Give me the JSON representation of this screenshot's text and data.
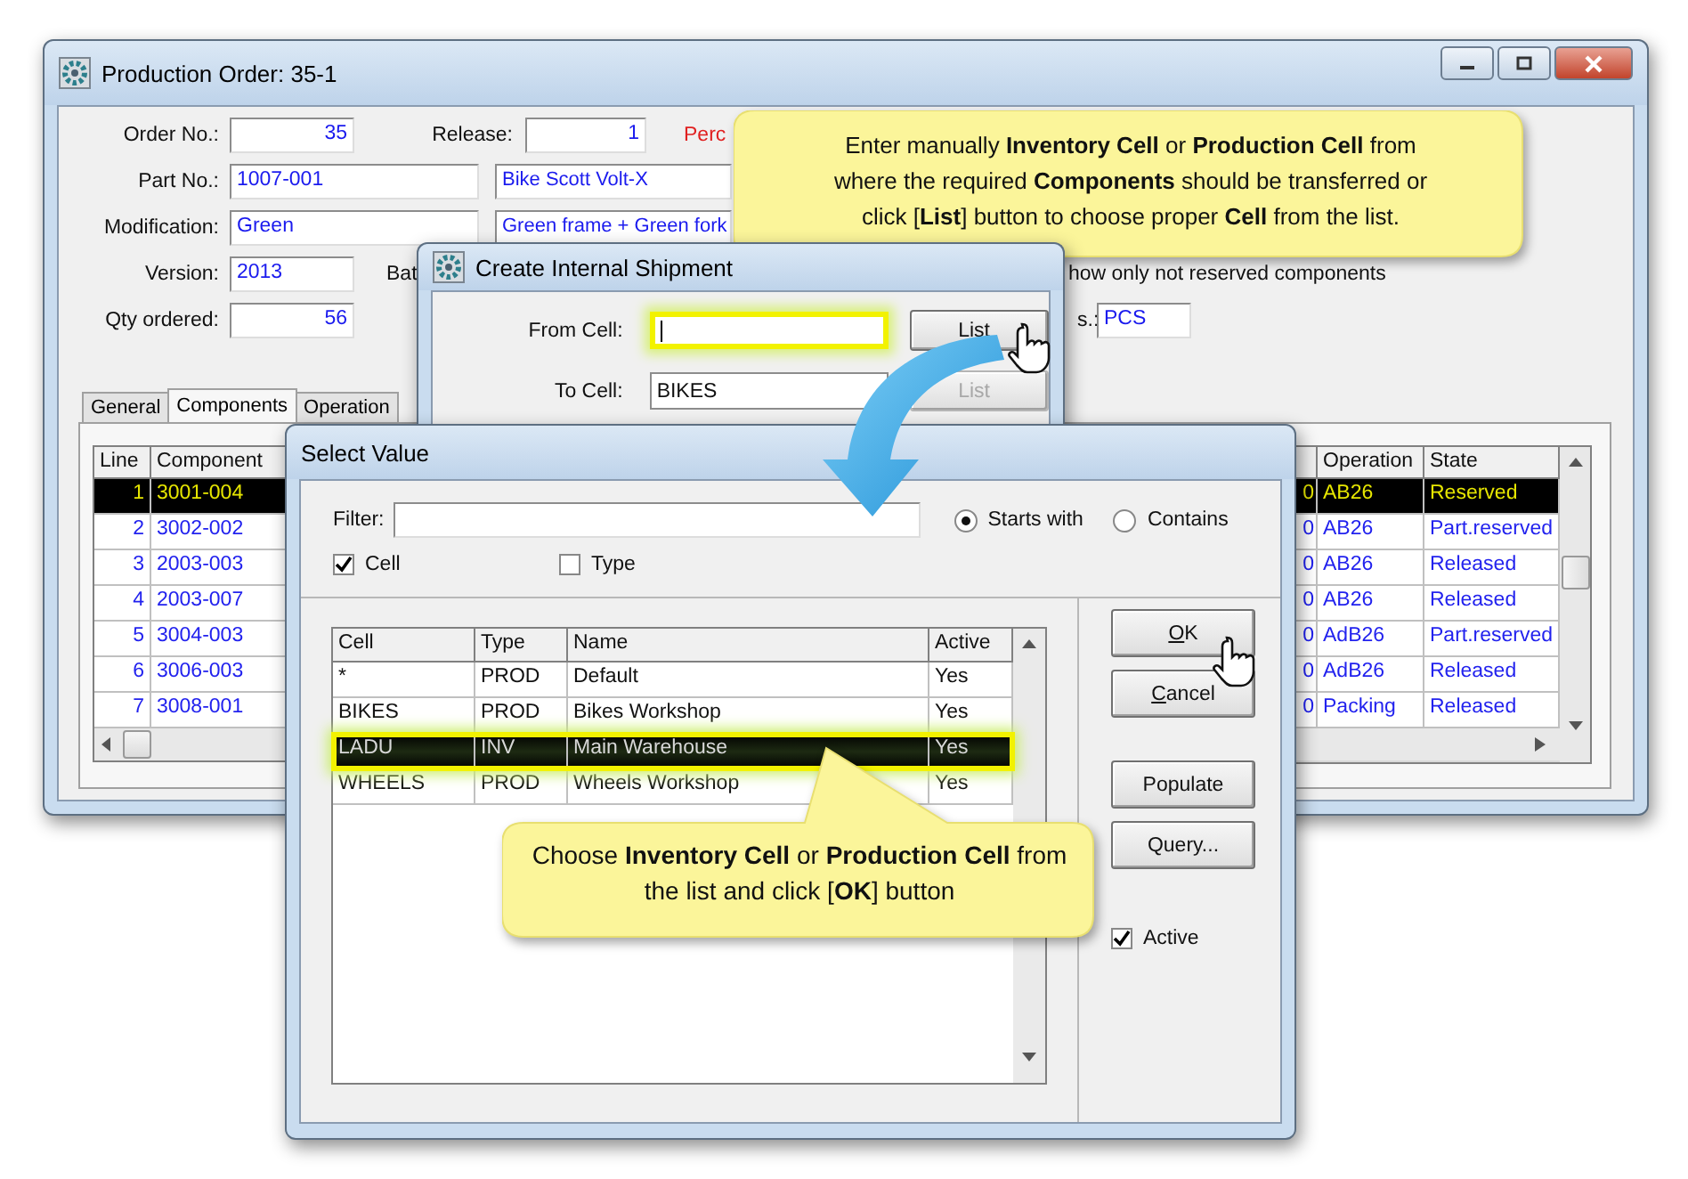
{
  "production_order_window": {
    "title": "Production Order: 35-1",
    "order_no": {
      "label": "Order No.:",
      "value": "35"
    },
    "release": {
      "label": "Release:",
      "value": "1"
    },
    "perc_label": "Perc",
    "part_no": {
      "label": "Part No.:",
      "value": "1007-001",
      "description": "Bike Scott Volt-X"
    },
    "modification": {
      "label": "Modification:",
      "value": "Green",
      "description": "Green frame + Green fork"
    },
    "version": {
      "label": "Version:",
      "value": "2013"
    },
    "batch_label": "Bat",
    "reserved_filter_text": "how only not reserved components",
    "qty_ordered": {
      "label": "Qty ordered:",
      "value": "56"
    },
    "unit": {
      "label": "s.:",
      "value": "PCS"
    },
    "tabs": [
      {
        "label": "General",
        "selected": false
      },
      {
        "label": "Components",
        "selected": true
      },
      {
        "label": "Operation",
        "selected": false
      }
    ],
    "components_table": {
      "left_columns": [
        "Line",
        "Component"
      ],
      "right_columns": [
        "Operation",
        "State"
      ],
      "rows": [
        {
          "line": "1",
          "component": "3001-004",
          "column_3": "0",
          "operation": "AB26",
          "state": "Reserved",
          "selected": true
        },
        {
          "line": "2",
          "component": "3002-002",
          "column_3": "0",
          "operation": "AB26",
          "state": "Part.reserved",
          "selected": false
        },
        {
          "line": "3",
          "component": "2003-003",
          "column_3": "0",
          "operation": "AB26",
          "state": "Released",
          "selected": false
        },
        {
          "line": "4",
          "component": "2003-007",
          "column_3": "0",
          "operation": "AB26",
          "state": "Released",
          "selected": false
        },
        {
          "line": "5",
          "component": "3004-003",
          "column_3": "0",
          "operation": "AdB26",
          "state": "Part.reserved",
          "selected": false
        },
        {
          "line": "6",
          "component": "3006-003",
          "column_3": "0",
          "operation": "AdB26",
          "state": "Released",
          "selected": false
        },
        {
          "line": "7",
          "component": "3008-001",
          "column_3": "0",
          "operation": "Packing",
          "state": "Released",
          "selected": false
        }
      ]
    }
  },
  "shipment_dialog": {
    "title": "Create Internal Shipment",
    "from_cell": {
      "label": "From Cell:",
      "highlighted": true
    },
    "to_cell": {
      "label": "To Cell:",
      "value": "BIKES"
    },
    "list_buttons": [
      {
        "label": "List",
        "disabled": false
      },
      {
        "label": "List",
        "disabled": true
      }
    ]
  },
  "select_value_dialog": {
    "title": "Select Value",
    "filter_label": "Filter:",
    "match_modes": [
      {
        "label": "Starts with",
        "selected": true
      },
      {
        "label": "Contains",
        "selected": false
      }
    ],
    "search_fields": [
      {
        "label": "Cell",
        "checked": true
      },
      {
        "label": "Type",
        "checked": false
      }
    ],
    "list": {
      "columns": [
        "Cell",
        "Type",
        "Name",
        "Active"
      ],
      "rows": [
        {
          "cell": "*",
          "type": "PROD",
          "name": "Default",
          "active": "Yes",
          "selected": false
        },
        {
          "cell": "BIKES",
          "type": "PROD",
          "name": "Bikes Workshop",
          "active": "Yes",
          "selected": false
        },
        {
          "cell": "LADU",
          "type": "INV",
          "name": "Main Warehouse",
          "active": "Yes",
          "selected": true
        },
        {
          "cell": "WHEELS",
          "type": "PROD",
          "name": "Wheels Workshop",
          "active": "Yes",
          "selected": false
        }
      ]
    },
    "buttons": [
      {
        "label": "OK",
        "mnemonic": true
      },
      {
        "label": "Cancel",
        "mnemonic": true
      },
      {
        "label": "Populate",
        "mnemonic": false
      },
      {
        "label": "Query...",
        "mnemonic": false
      }
    ],
    "active_filter": {
      "label": "Active",
      "checked": true
    }
  },
  "callouts": [
    {
      "text": "Enter manually **Inventory Cell** or **Production Cell** from where the required **Components** should be transferred or click [**List**] button to choose proper **Cell** from the list."
    },
    {
      "text": "Choose **Inventory Cell** or **Production Cell** from the list and click [**OK**] button"
    }
  ]
}
